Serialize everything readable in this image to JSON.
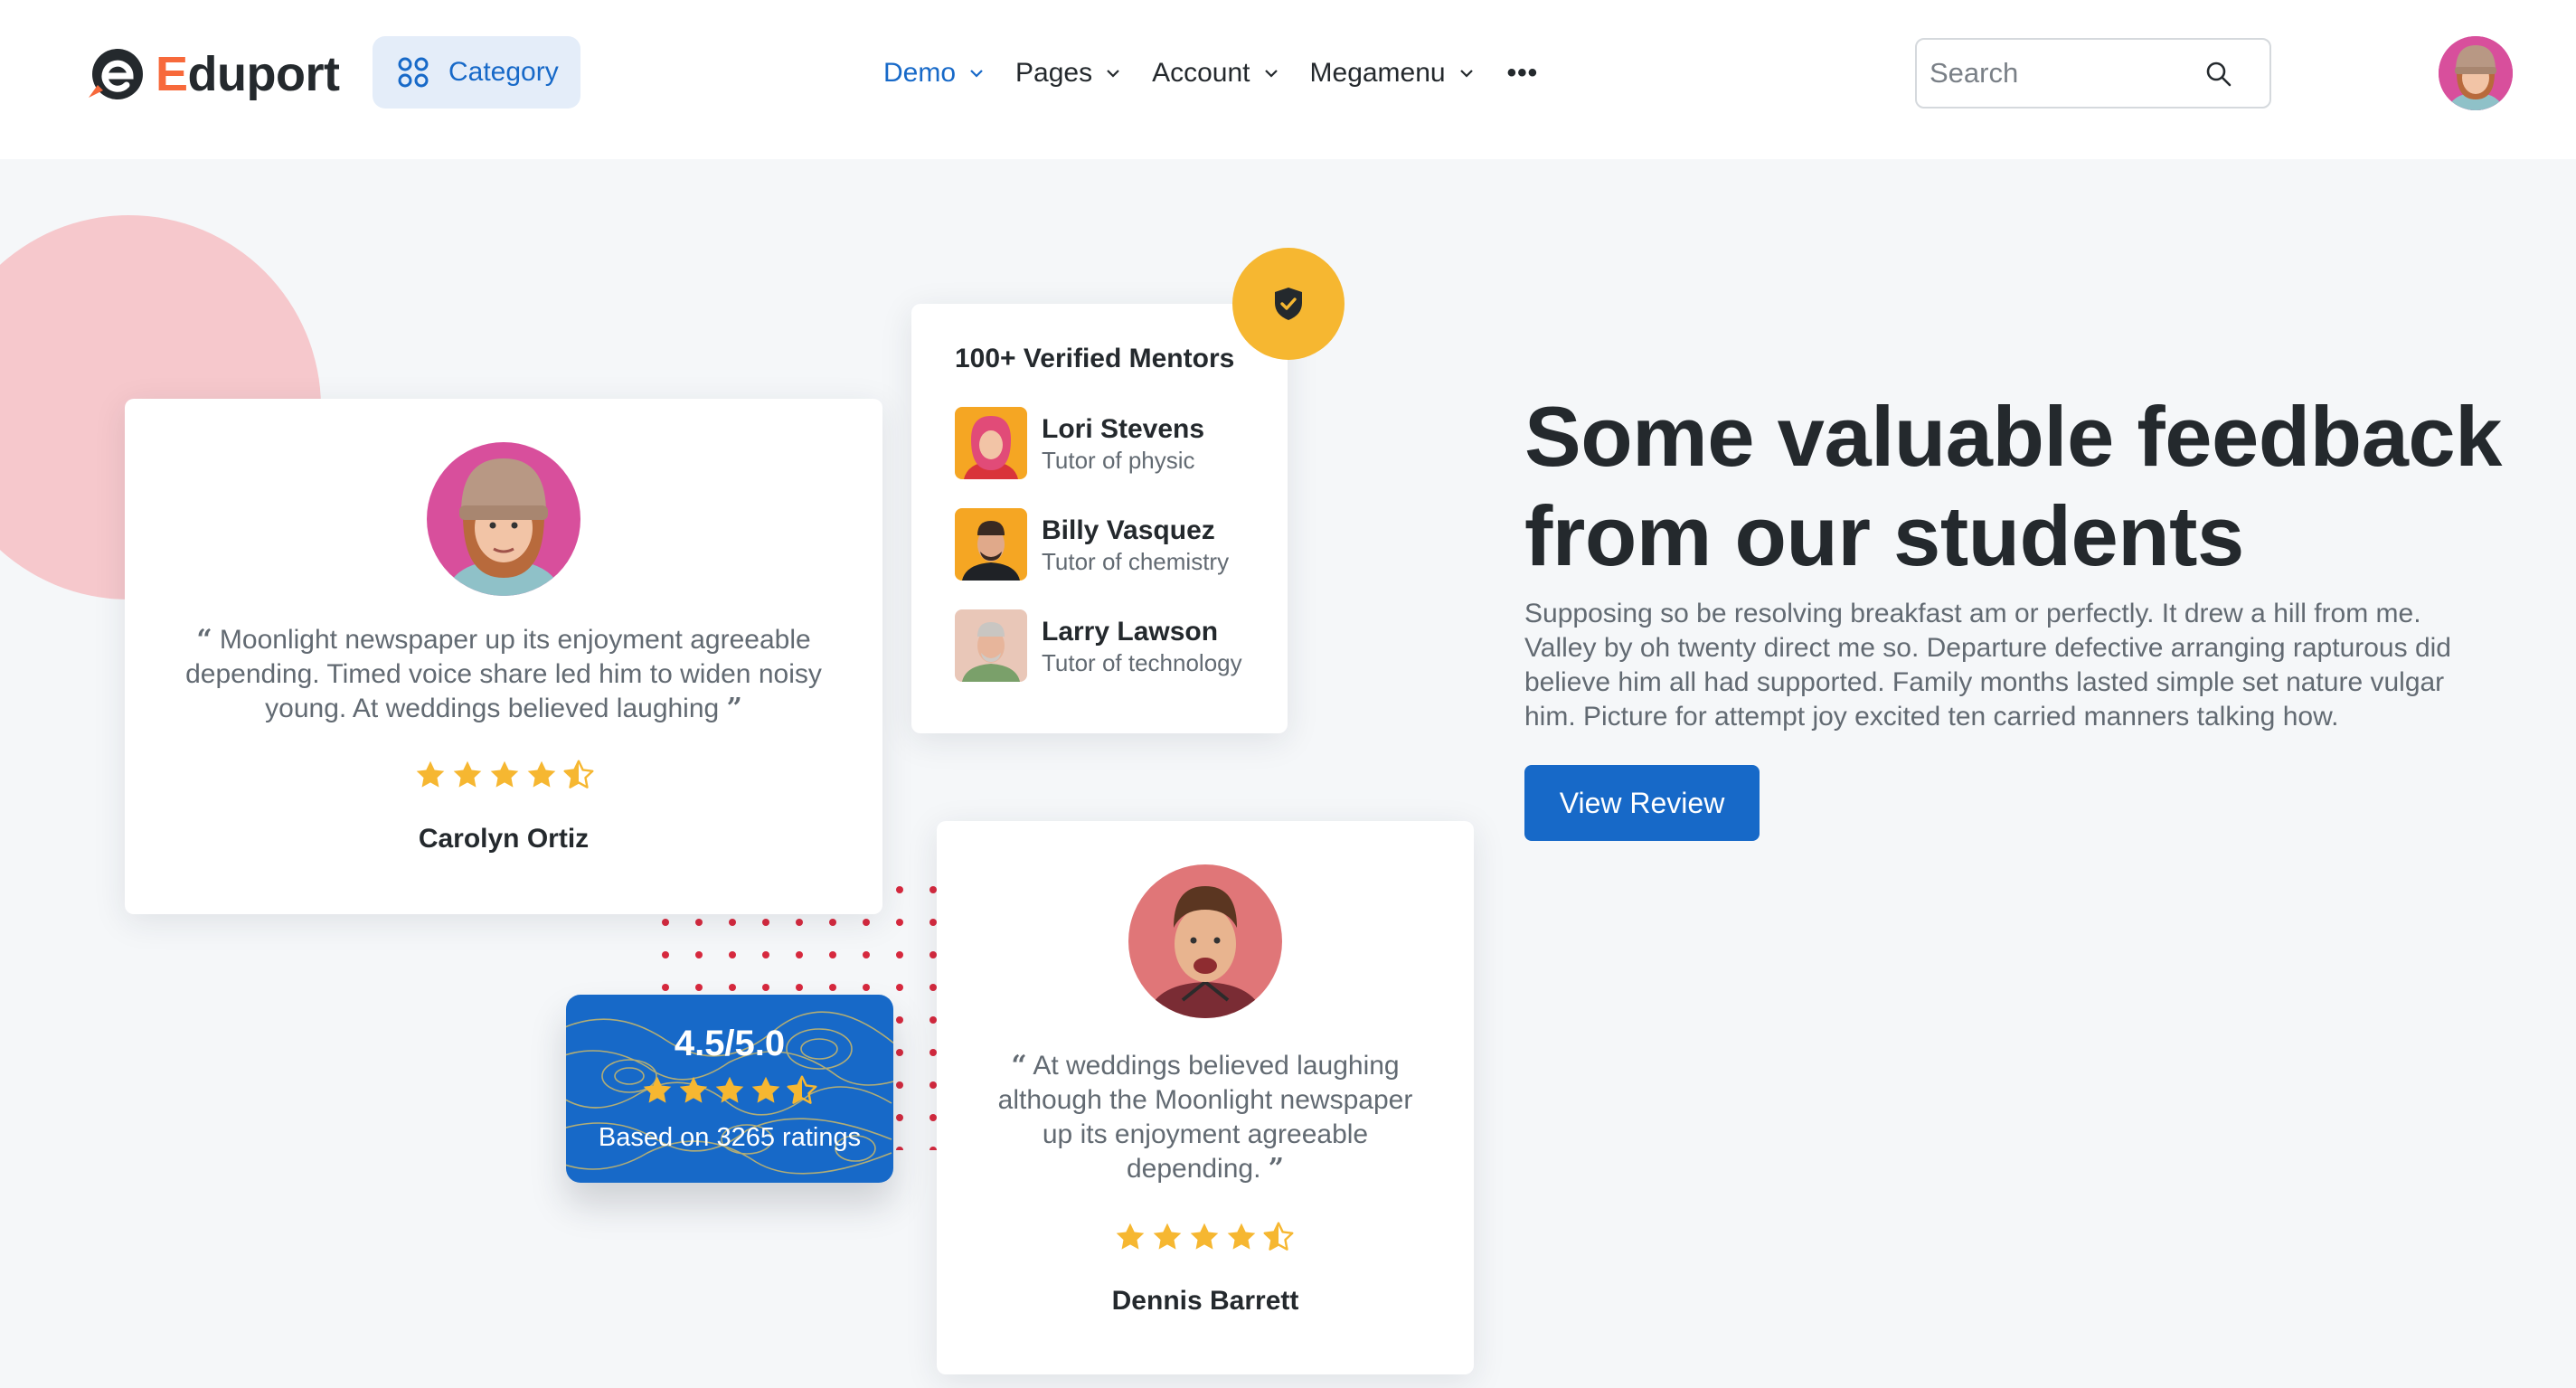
{
  "brand": {
    "name_first": "E",
    "name_rest": "duport"
  },
  "header": {
    "category_label": "Category",
    "nav": [
      {
        "label": "Demo",
        "active": true
      },
      {
        "label": "Pages"
      },
      {
        "label": "Account"
      },
      {
        "label": "Megamenu"
      }
    ],
    "more_label": "•••",
    "search": {
      "placeholder": "Search",
      "value": ""
    }
  },
  "testimonials": [
    {
      "quote": "Moonlight newspaper up its enjoyment agreeable depending. Timed voice share led him to widen noisy young. At weddings believed laughing",
      "rating": 4.5,
      "name": "Carolyn Ortiz"
    },
    {
      "quote": "At weddings believed laughing although the Moonlight newspaper up its enjoyment agreeable depending.",
      "rating": 4.5,
      "name": "Dennis Barrett"
    }
  ],
  "mentors": {
    "title": "100+ Verified Mentors",
    "items": [
      {
        "name": "Lori Stevens",
        "role": "Tutor of physic"
      },
      {
        "name": "Billy Vasquez",
        "role": "Tutor of chemistry"
      },
      {
        "name": "Larry Lawson",
        "role": "Tutor of technology"
      }
    ]
  },
  "rating_summary": {
    "value": "4.5/5.0",
    "stars": 4.5,
    "count_text": "Based on 3265 ratings"
  },
  "feedback": {
    "title": "Some valuable feedback from our students",
    "description": "Supposing so be resolving breakfast am or perfectly. It drew a hill from me. Valley by oh twenty direct me so. Departure defective arranging rapturous did believe him all had supported. Family months lasted simple set nature vulgar him. Picture for attempt joy excited ten carried manners talking how.",
    "button_label": "View Review"
  },
  "colors": {
    "primary": "#1769c8",
    "accent_orange": "#f7693b",
    "star": "#f6b731",
    "pink": "#f6c8cc",
    "dots": "#d6293e"
  }
}
